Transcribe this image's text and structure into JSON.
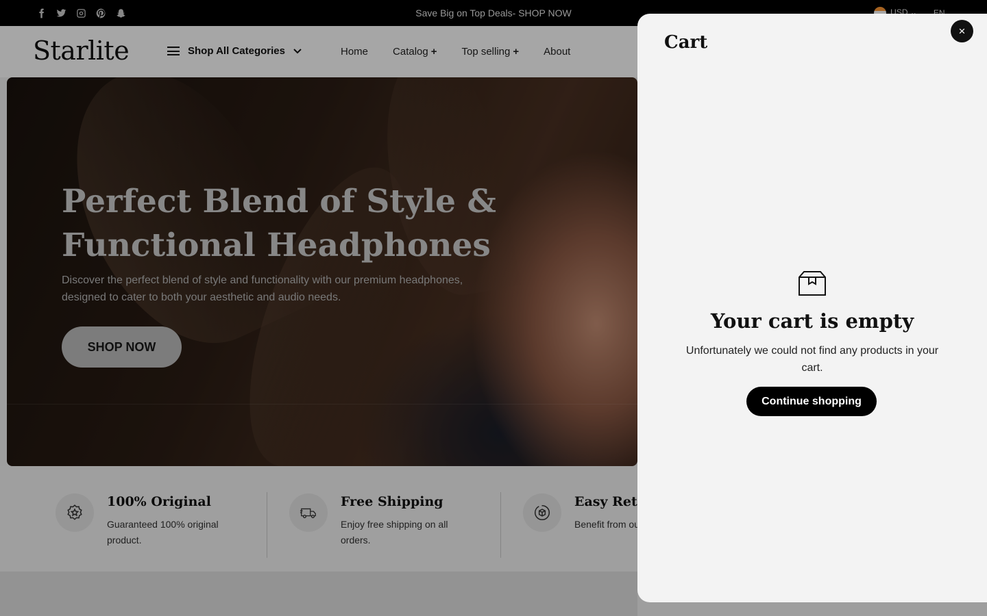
{
  "topbar": {
    "announcement": "Save Big on Top Deals- SHOP NOW",
    "socials": [
      "facebook-icon",
      "twitter-icon",
      "instagram-icon",
      "pinterest-icon",
      "snapchat-icon"
    ],
    "currency": "USD",
    "language": "EN"
  },
  "header": {
    "logo": "Starlite",
    "categories_label": "Shop All Categories",
    "nav": [
      {
        "label": "Home",
        "plus": ""
      },
      {
        "label": "Catalog",
        "plus": "+"
      },
      {
        "label": "Top selling",
        "plus": "+"
      },
      {
        "label": "About",
        "plus": ""
      }
    ]
  },
  "hero": {
    "title_line1": "Perfect Blend of Style &",
    "title_line2": "Functional Headphones",
    "text_line1": "Discover the perfect blend of style and functionality with our premium headphones,",
    "text_line2": "designed to cater to both your aesthetic and audio needs.",
    "button": "SHOP NOW"
  },
  "features": [
    {
      "icon": "badge-star-icon",
      "title": "100% Original",
      "text": "Guaranteed 100% original product."
    },
    {
      "icon": "truck-icon",
      "title": "Free Shipping",
      "text": "Enjoy free shipping on all orders."
    },
    {
      "icon": "returns-box-icon",
      "title": "Easy Returns",
      "text": "Benefit from our returns policy."
    }
  ],
  "cart": {
    "title": "Cart",
    "empty_title": "Your cart is empty",
    "empty_text": "Unfortunately we could not find any products in your cart.",
    "continue": "Continue shopping",
    "close": "×"
  },
  "colors": {
    "accent": "#000000",
    "drawer_bg": "#f3f3f3",
    "overlay": "rgba(0,0,0,0.35)"
  }
}
